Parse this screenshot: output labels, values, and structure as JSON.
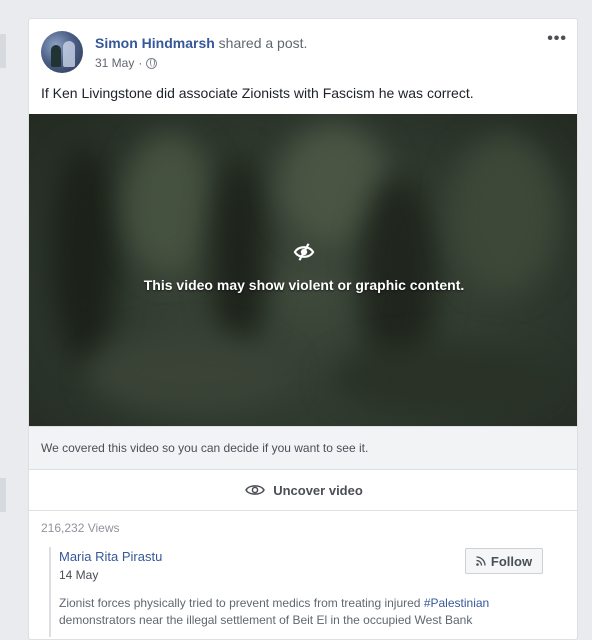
{
  "post": {
    "author": "Simon Hindmarsh",
    "action": " shared a post.",
    "date": "31 May",
    "separator": " · ",
    "more_icon": "•••",
    "text": "If Ken Livingstone did associate Zionists with Fascism he was correct."
  },
  "video": {
    "warning": "This video may show violent or graphic content.",
    "notice": "We covered this video so you can decide if you want to see it.",
    "uncover_label": "Uncover video"
  },
  "stats": {
    "views": "216,232 Views"
  },
  "shared": {
    "author": "Maria Rita Pirastu",
    "date": "14 May",
    "follow_label": "Follow",
    "text_before": "Zionist forces physically tried to prevent medics from treating injured ",
    "hashtag": "#Palestinian",
    "text_after": " demonstrators near the illegal settlement of Beit El in the occupied West Bank"
  },
  "colors": {
    "link": "#365899",
    "page_bg": "#e9ebee",
    "video_bg": "#303a2f"
  },
  "icons": [
    "globe-icon",
    "more-icon",
    "eye-slash-icon",
    "eye-icon",
    "rss-icon"
  ]
}
